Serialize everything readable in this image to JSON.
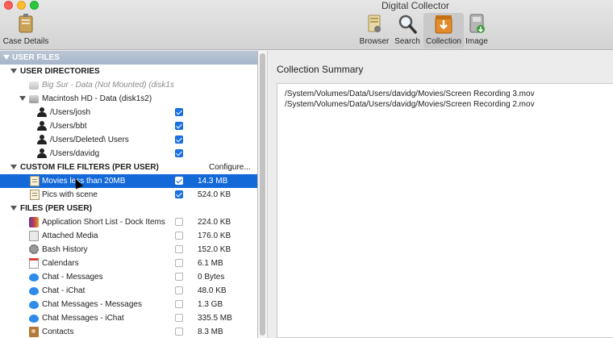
{
  "window": {
    "title": "Digital Collector"
  },
  "toolbar": {
    "case_details": "Case Details",
    "browser": "Browser",
    "search": "Search",
    "collection": "Collection",
    "image": "Image"
  },
  "left": {
    "section_title": "USER FILES",
    "user_directories": {
      "header": "USER DIRECTORIES",
      "volumes": [
        {
          "label": "Big Sur - Data (Not Mounted) (disk1s",
          "dimmed": true
        },
        {
          "label": "Macintosh HD - Data (disk1s2)",
          "dimmed": false
        }
      ],
      "users": [
        {
          "label": "/Users/josh",
          "checked": true
        },
        {
          "label": "/Users/bbt",
          "checked": true
        },
        {
          "label": "/Users/Deleted\\ Users",
          "checked": true
        },
        {
          "label": "/Users/davidg",
          "checked": true
        }
      ]
    },
    "custom_filters": {
      "header": "CUSTOM FILE FILTERS (PER USER)",
      "configure": "Configure...",
      "items": [
        {
          "label": "Movies less than 20MB",
          "checked": true,
          "size": "14.3 MB",
          "selected": true
        },
        {
          "label": "Pics with scene",
          "checked": true,
          "size": "524.0 KB",
          "selected": false
        }
      ]
    },
    "files": {
      "header": "FILES (PER USER)",
      "items": [
        {
          "label": "Application Short List - Dock Items",
          "checked": false,
          "size": "224.0 KB",
          "icon": "apps-icon"
        },
        {
          "label": "Attached Media",
          "checked": false,
          "size": "176.0 KB",
          "icon": "media-icon"
        },
        {
          "label": "Bash History",
          "checked": false,
          "size": "152.0 KB",
          "icon": "gear-icon"
        },
        {
          "label": "Calendars",
          "checked": false,
          "size": "6.1 MB",
          "icon": "calendar-icon"
        },
        {
          "label": "Chat - Messages",
          "checked": false,
          "size": "0 Bytes",
          "icon": "chat-bubble-icon"
        },
        {
          "label": "Chat - iChat",
          "checked": false,
          "size": "48.0 KB",
          "icon": "chat-bubble-icon"
        },
        {
          "label": "Chat Messages - Messages",
          "checked": false,
          "size": "1.3 GB",
          "icon": "chat-bubble-icon"
        },
        {
          "label": "Chat Messages - iChat",
          "checked": false,
          "size": "335.5 MB",
          "icon": "chat-bubble-icon"
        },
        {
          "label": "Contacts",
          "checked": false,
          "size": "8.3 MB",
          "icon": "contacts-icon"
        }
      ]
    }
  },
  "right": {
    "title": "Collection Summary",
    "lines": [
      "/System/Volumes/Data/Users/davidg/Movies/Screen Recording 3.mov",
      "/System/Volumes/Data/Users/davidg/Movies/Screen Recording 2.mov"
    ]
  },
  "colors": {
    "selection": "#1469d9",
    "accent": "#1a73e8",
    "section_bar": "#a7b6ca"
  }
}
